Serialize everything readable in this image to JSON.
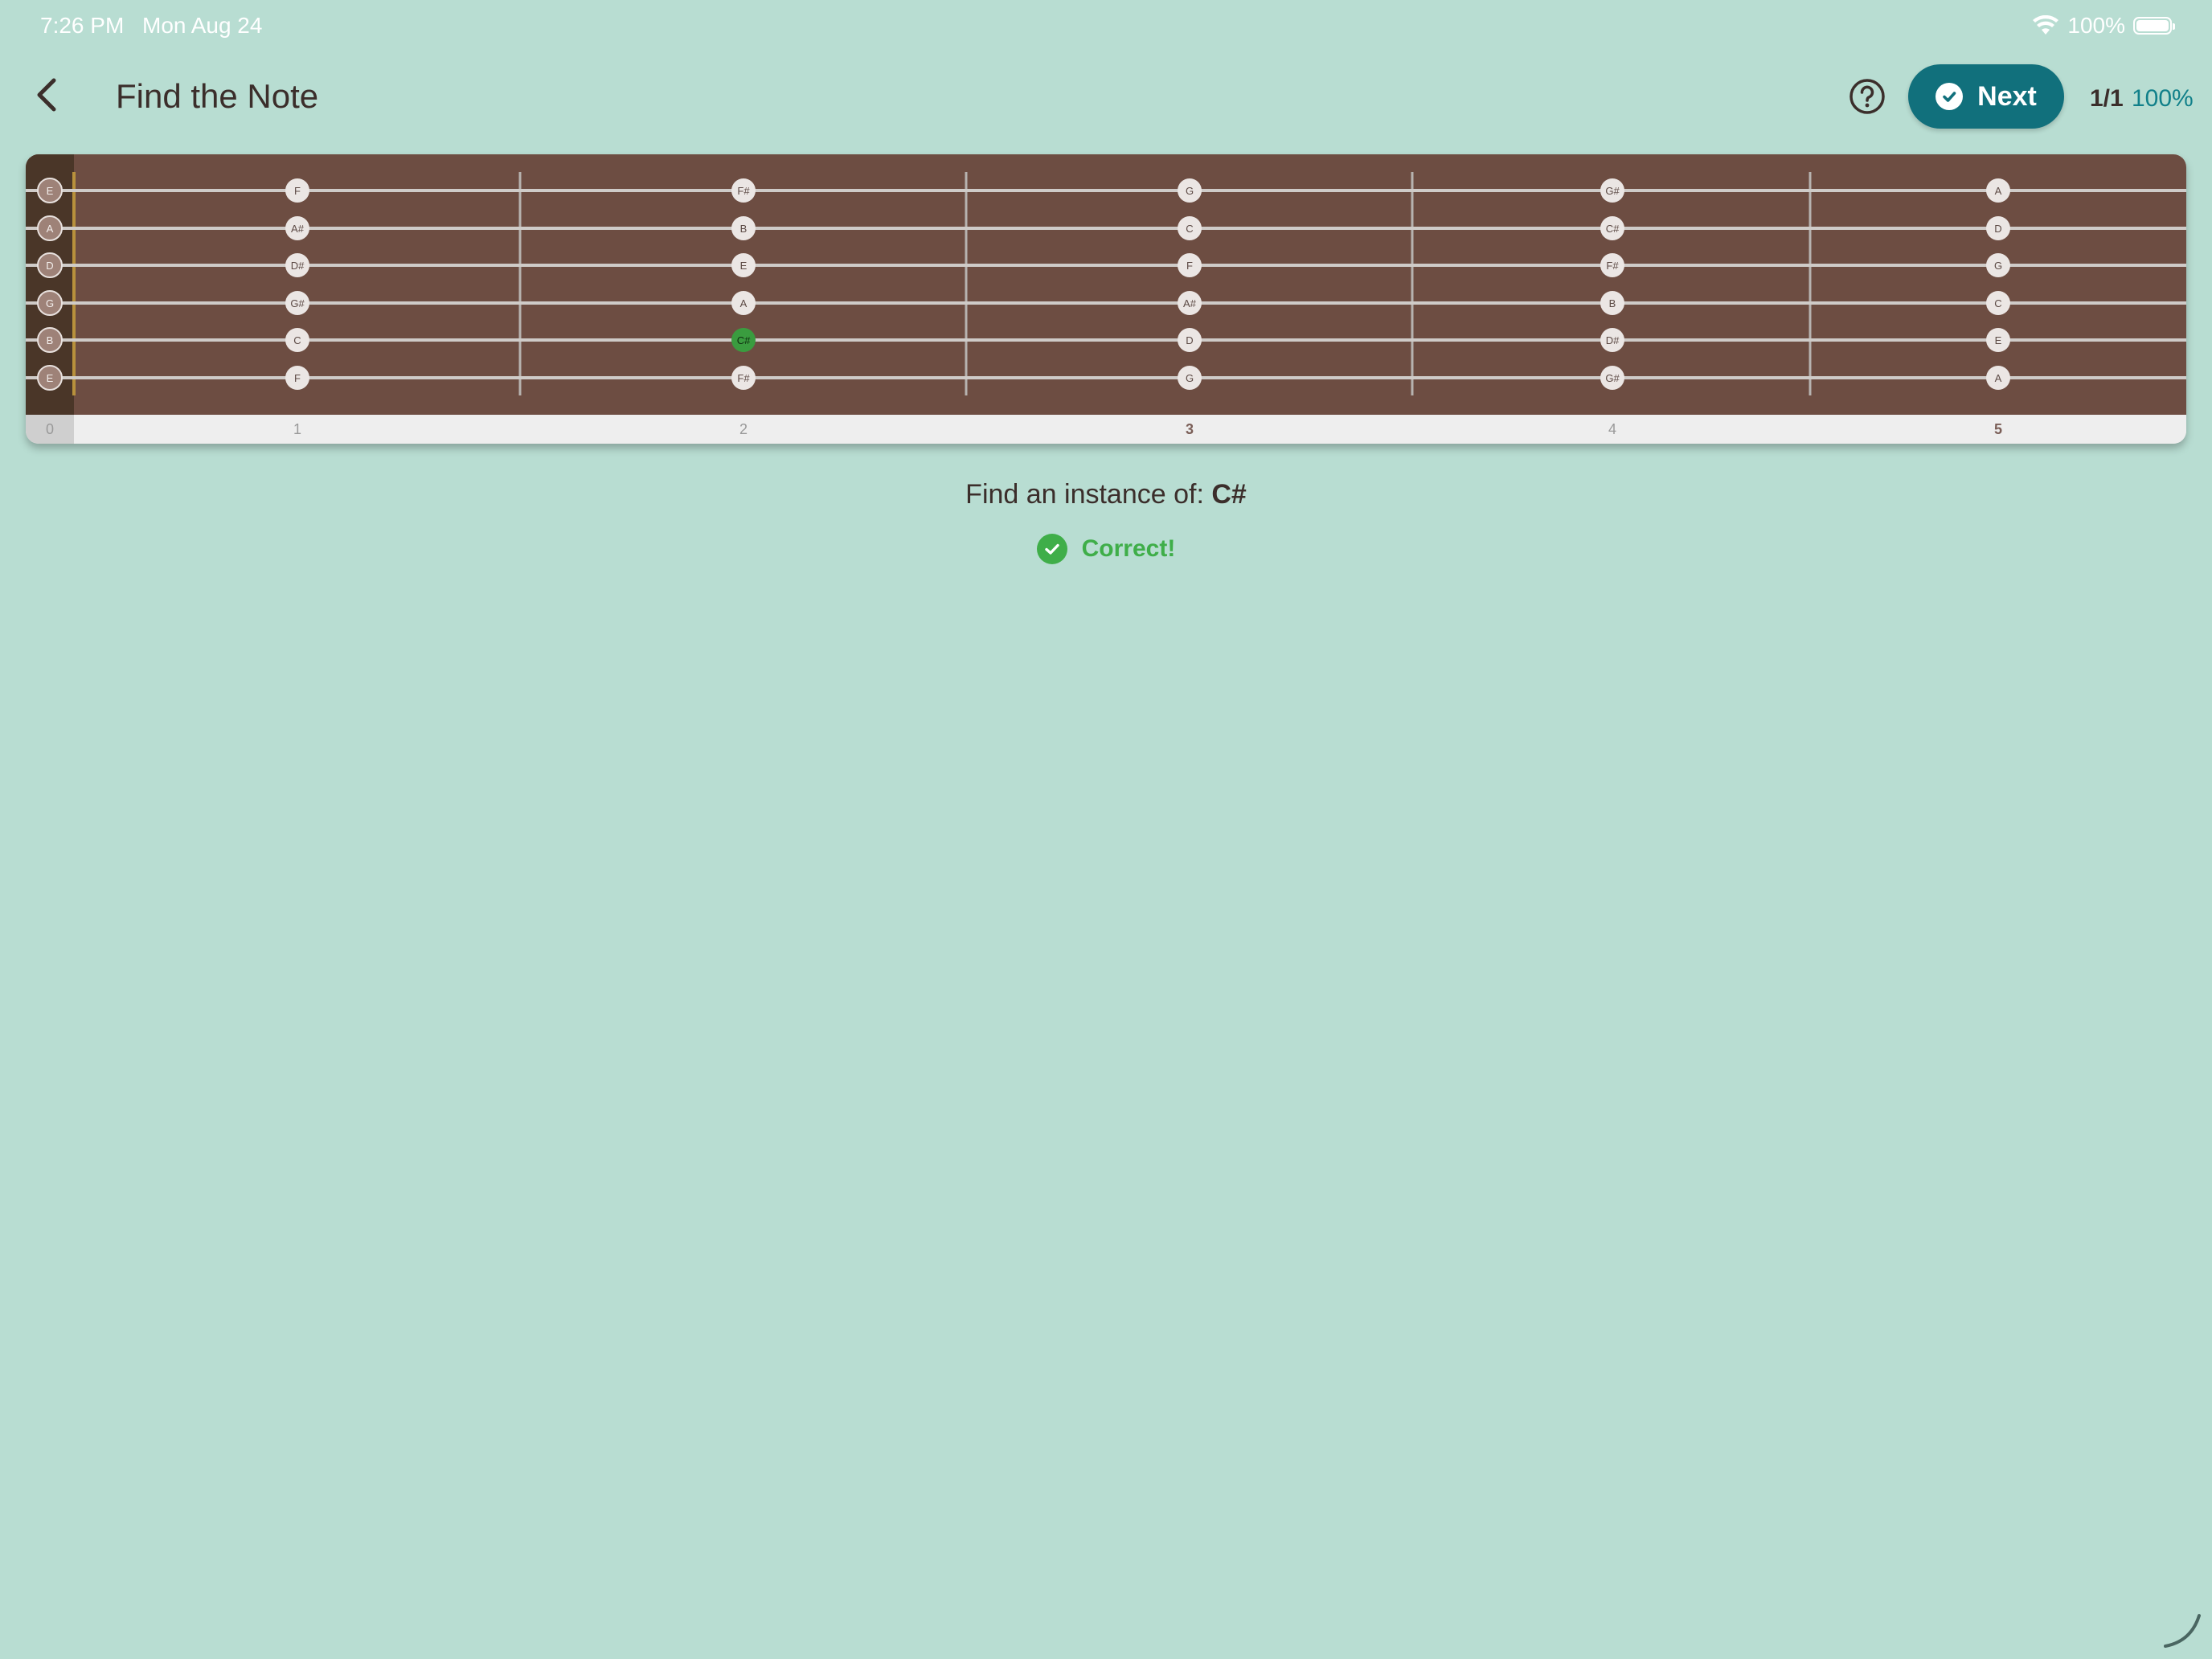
{
  "status_bar": {
    "time": "7:26 PM",
    "date": "Mon Aug 24",
    "battery_text": "100%"
  },
  "header": {
    "title": "Find the Note",
    "next_label": "Next",
    "progress_count": "1/1",
    "progress_percent": "100%"
  },
  "fretboard": {
    "wood_color": "#6d4d42",
    "nut_color": "#4a3628",
    "highlight_color": "#3a9c3f",
    "string_names": [
      "E",
      "A",
      "D",
      "G",
      "B",
      "E"
    ],
    "fret_numbers": [
      "0",
      "1",
      "2",
      "3",
      "4",
      "5"
    ],
    "notes": [
      [
        "F",
        "F#",
        "G",
        "G#",
        "A"
      ],
      [
        "A#",
        "B",
        "C",
        "C#",
        "D"
      ],
      [
        "D#",
        "E",
        "F",
        "F#",
        "G"
      ],
      [
        "G#",
        "A",
        "A#",
        "B",
        "C"
      ],
      [
        "C",
        "C#",
        "D",
        "D#",
        "E"
      ],
      [
        "F",
        "F#",
        "G",
        "G#",
        "A"
      ]
    ],
    "selected": {
      "string": 4,
      "fret": 2
    }
  },
  "prompt": {
    "text": "Find an instance of: ",
    "note": "C#"
  },
  "feedback": {
    "text": "Correct!"
  }
}
